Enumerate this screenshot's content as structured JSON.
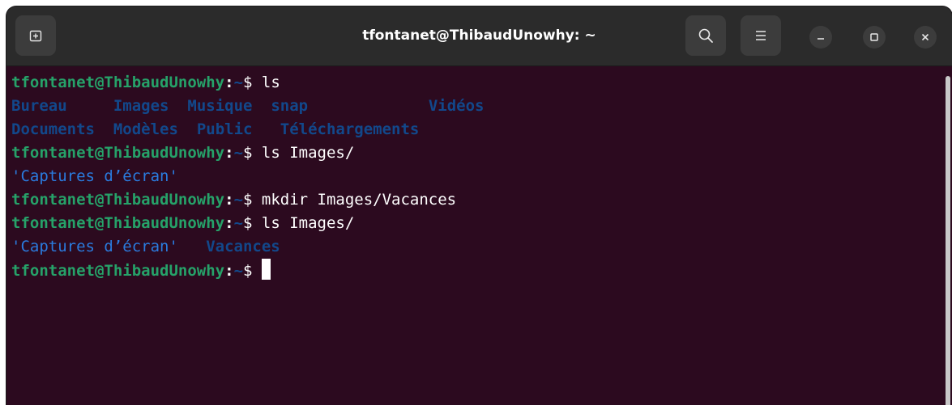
{
  "window": {
    "title": "tfontanet@ThibaudUnowhy: ~"
  },
  "titlebar": {
    "new_tab_icon": "new-tab-icon",
    "search_icon": "search-icon",
    "menu_icon": "hamburger-menu-icon",
    "minimize_icon": "minimize-icon",
    "maximize_icon": "maximize-icon",
    "close_icon": "close-icon"
  },
  "colors": {
    "terminal_background": "#2c0a1f",
    "prompt_user": "#26a269",
    "directory": "#12488b",
    "quoted_name": "#2a7bde",
    "titlebar": "#2b2b2b"
  },
  "prompt": {
    "user_host": "tfontanet@ThibaudUnowhy",
    "colon": ":",
    "path": "~",
    "symbol": "$"
  },
  "terminal": {
    "cmd1": " ls",
    "ls1_row1": [
      "Bureau",
      "Images",
      "Musique",
      "snap",
      "Vidéos"
    ],
    "ls1_row2": [
      "Documents",
      "Modèles",
      "Public",
      "Téléchargements"
    ],
    "cmd2": " ls Images/",
    "out2": "'Captures d’écran'",
    "cmd3": " mkdir Images/Vacances",
    "cmd4": " ls Images/",
    "out4_quoted": "'Captures d’écran'",
    "out4_dir": "Vacances",
    "cmd5": " "
  }
}
